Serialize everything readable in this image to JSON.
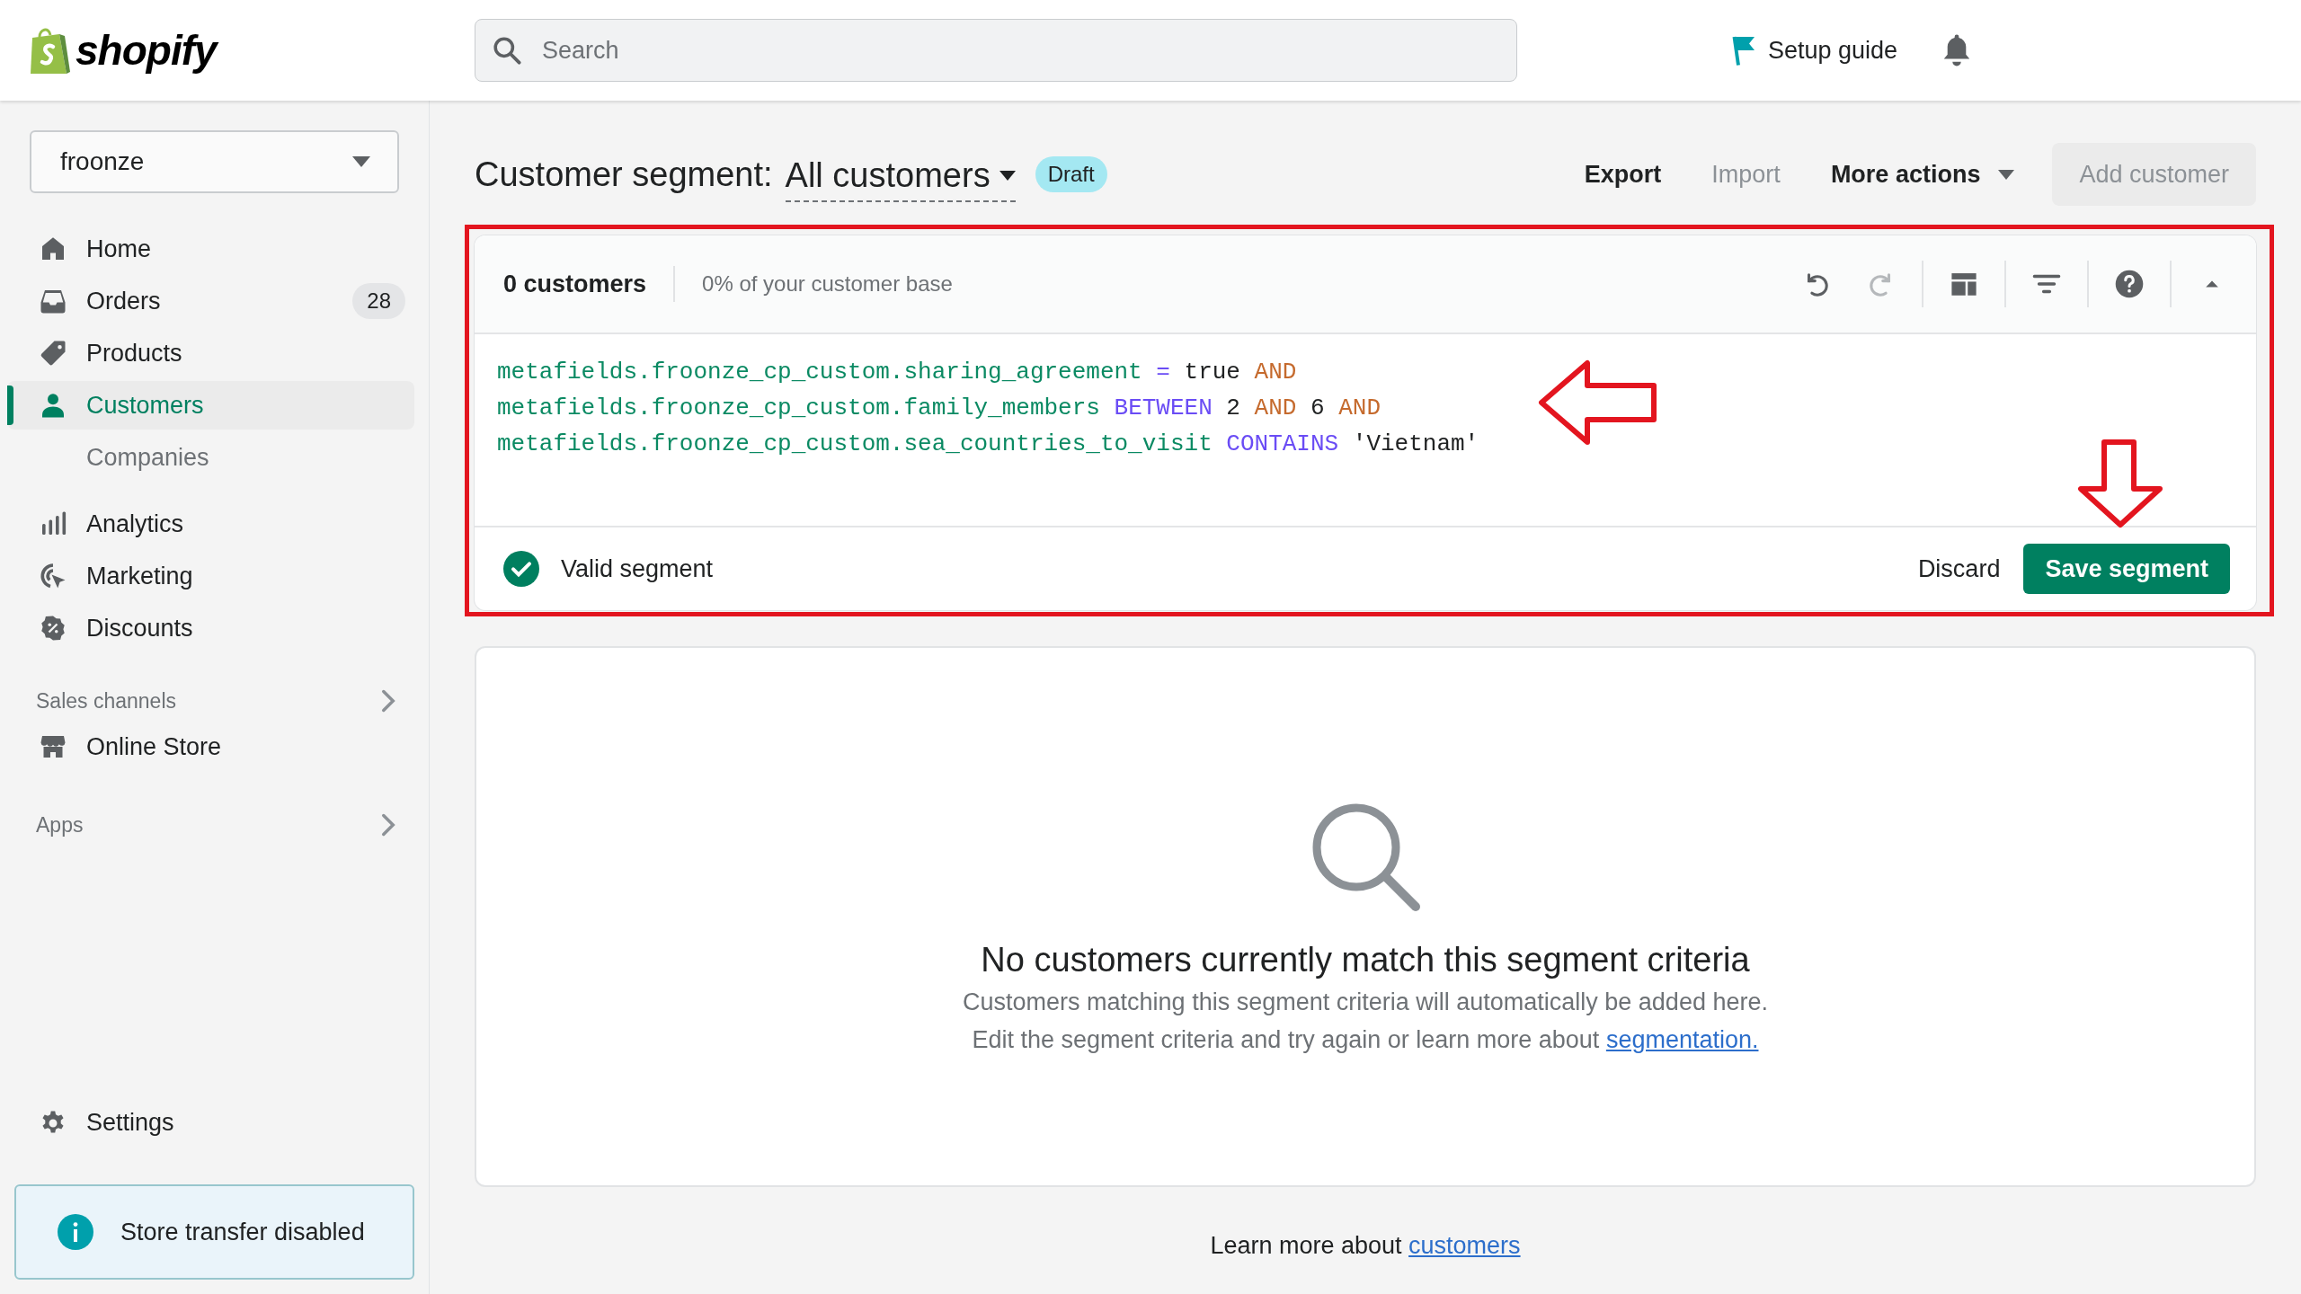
{
  "header": {
    "logo": "shopify",
    "search": {
      "placeholder": "Search"
    },
    "setup_guide": "Setup guide"
  },
  "sidebar": {
    "store": "froonze",
    "nav": [
      {
        "label": "Home",
        "selected": false
      },
      {
        "label": "Orders",
        "selected": false,
        "badge": "28"
      },
      {
        "label": "Products",
        "selected": false
      },
      {
        "label": "Customers",
        "selected": true,
        "children": [
          {
            "label": "Companies",
            "selected": false
          }
        ]
      },
      {
        "label": "Analytics",
        "selected": false
      },
      {
        "label": "Marketing",
        "selected": false
      },
      {
        "label": "Discounts",
        "selected": false
      }
    ],
    "sales_channels": {
      "title": "Sales channels",
      "items": [
        {
          "label": "Online Store",
          "selected": false
        }
      ]
    },
    "apps": {
      "title": "Apps"
    },
    "settings": {
      "label": "Settings",
      "selected": false
    },
    "notice": "Store transfer disabled"
  },
  "page": {
    "title": "Customer segment:",
    "segment": "All customers",
    "badge": "Draft",
    "actions": [
      {
        "label": "Export",
        "disabled": false,
        "dropdown": false
      },
      {
        "label": "Import",
        "disabled": true,
        "dropdown": false
      },
      {
        "label": "More actions",
        "disabled": false,
        "dropdown": true
      }
    ],
    "add_button": {
      "label": "Add customer",
      "disabled": true
    }
  },
  "editor": {
    "count": "0 customers",
    "share": "0% of your customer base",
    "undo": {
      "disabled": false
    },
    "redo": {
      "disabled": true
    },
    "lines": [
      [
        {
          "kind": "field",
          "text": "metafields.froonze_cp_custom.sharing_agreement"
        },
        {
          "kind": "operator",
          "text": "="
        },
        {
          "kind": "value",
          "text": "true"
        },
        {
          "kind": "keyword",
          "text": "AND"
        }
      ],
      [
        {
          "kind": "field",
          "text": "metafields.froonze_cp_custom.family_members"
        },
        {
          "kind": "operator",
          "text": "BETWEEN"
        },
        {
          "kind": "value",
          "text": "2"
        },
        {
          "kind": "keyword",
          "text": "AND"
        },
        {
          "kind": "value",
          "text": "6"
        },
        {
          "kind": "keyword",
          "text": "AND"
        }
      ],
      [
        {
          "kind": "field",
          "text": "metafields.froonze_cp_custom.sea_countries_to_visit"
        },
        {
          "kind": "operator",
          "text": "CONTAINS"
        },
        {
          "kind": "value",
          "text": "'Vietnam'"
        }
      ]
    ],
    "status": {
      "valid": true,
      "text": "Valid segment"
    },
    "discard": "Discard",
    "save": "Save segment"
  },
  "empty_state": {
    "title": "No customers currently match this segment criteria",
    "line_1": "Customers matching this segment criteria will automatically be added here.",
    "line_2": "Edit the segment criteria and try again or learn more about ",
    "link": "segmentation."
  },
  "footer": {
    "text": "Learn more about ",
    "link": "customers"
  }
}
